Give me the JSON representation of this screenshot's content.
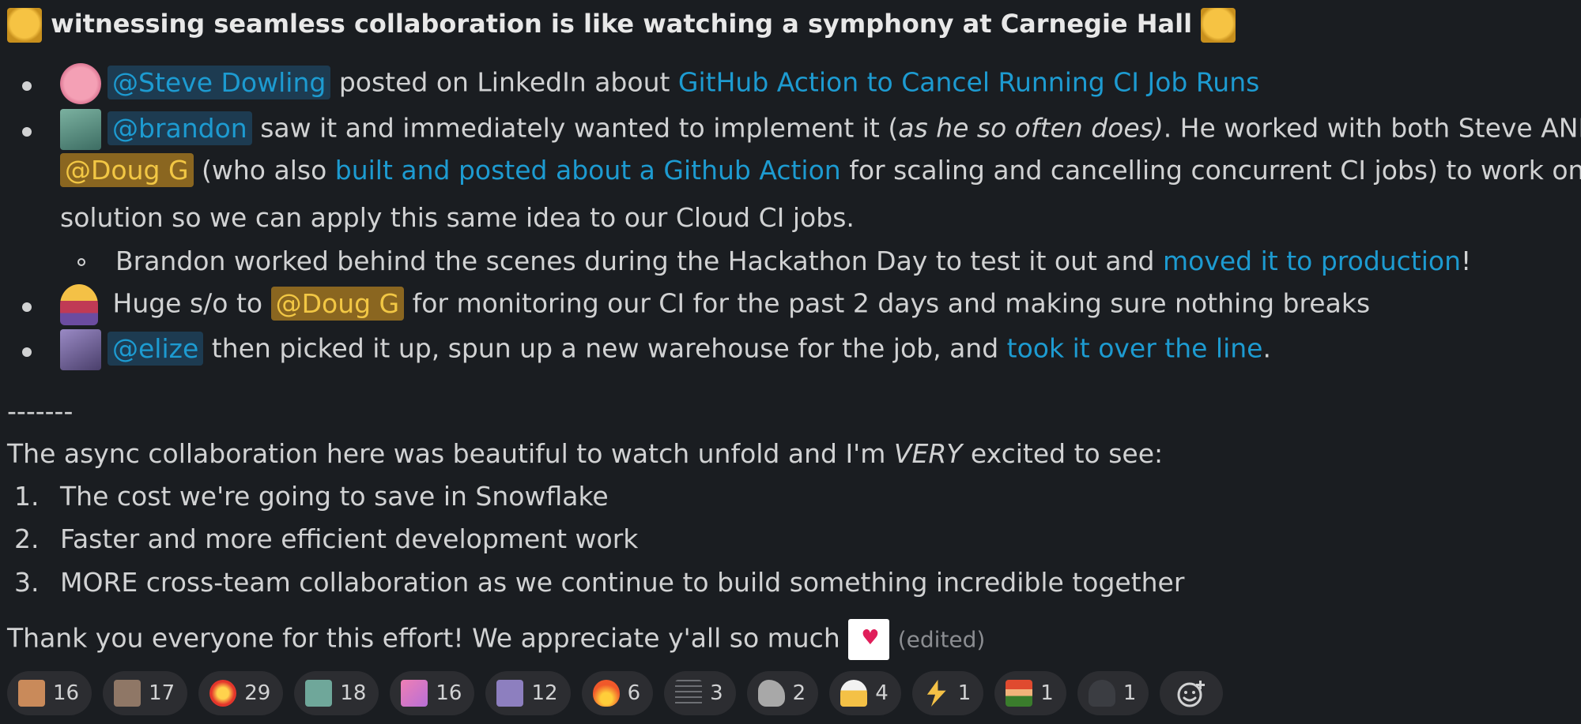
{
  "headline": "witnessing seamless collaboration is like watching a symphony at Carnegie Hall",
  "colors": {
    "background": "#1a1d21",
    "text": "#d1d2d3",
    "link": "#1d9bd1",
    "mention_bg": "#1d3b51",
    "mention_self_bg": "#8a6620",
    "mention_self_text": "#f2c744"
  },
  "bullets": {
    "b1": {
      "icon": "brain-emoji-icon",
      "mention": "@Steve Dowling",
      "text": "posted on LinkedIn about",
      "link": "GitHub Action to Cancel Running CI Job Runs"
    },
    "b2": {
      "icon": "brandon-avatar-icon",
      "mention": "@brandon",
      "text_a": "saw it and immediately wanted to implement it (",
      "italic": "as he so often does)",
      "text_b": ". He worked with both Steve AND",
      "mention2": "@Doug G",
      "text_c": "(who also",
      "link": "built and posted about a Github Action",
      "text_d": "for scaling and cancelling concurrent CI jobs) to work on a",
      "text_e": "solution so we can apply this same idea to our Cloud CI jobs.",
      "sub": {
        "text": "Brandon worked behind the scenes during the Hackathon Day to test it out and",
        "link": "moved it to production",
        "end": "!"
      }
    },
    "b3": {
      "icon": "superhero-emoji-icon",
      "text_a": "Huge s/o to",
      "mention": "@Doug G",
      "text_b": "for monitoring our CI for the past 2 days and making sure nothing breaks"
    },
    "b4": {
      "icon": "elize-avatar-icon",
      "mention": "@elize",
      "text": "then picked it up, spun up a new warehouse for the job, and",
      "link": "took it over the line",
      "end": "."
    }
  },
  "divider": "-------",
  "intro": {
    "a": "The async collaboration here was beautiful to watch unfold and I'm",
    "italic": "VERY",
    "b": "excited to see:"
  },
  "ordered": [
    {
      "num": "1.",
      "text": "The cost we're going to save in Snowflake"
    },
    {
      "num": "2.",
      "text": "Faster and more efficient development work"
    },
    {
      "num": "3.",
      "text": "MORE cross-team collaboration as we continue to build something incredible together"
    }
  ],
  "thanks": "Thank you everyone for this effort! We appreciate y'all so much",
  "edited": "(edited)",
  "reactions": [
    {
      "icon": "clap-emoji-icon",
      "count": "16"
    },
    {
      "icon": "face-avatar-emoji-icon",
      "count": "17"
    },
    {
      "icon": "collision-emoji-icon",
      "count": "29"
    },
    {
      "icon": "brandon-face-emoji-icon",
      "count": "18"
    },
    {
      "icon": "flamingo-emoji-icon",
      "count": "16"
    },
    {
      "icon": "elize-face-emoji-icon",
      "count": "12"
    },
    {
      "icon": "fire-emoji-icon",
      "count": "6"
    },
    {
      "icon": "sheet-music-emoji-icon",
      "count": "3"
    },
    {
      "icon": "flexed-arm-emoji-icon",
      "count": "2"
    },
    {
      "icon": "celebrate-emoji-icon",
      "count": "4"
    },
    {
      "icon": "lightning-emoji-icon",
      "count": "1"
    },
    {
      "icon": "pixel-character-emoji-icon",
      "count": "1"
    },
    {
      "icon": "darth-vader-emoji-icon",
      "count": "1"
    }
  ]
}
